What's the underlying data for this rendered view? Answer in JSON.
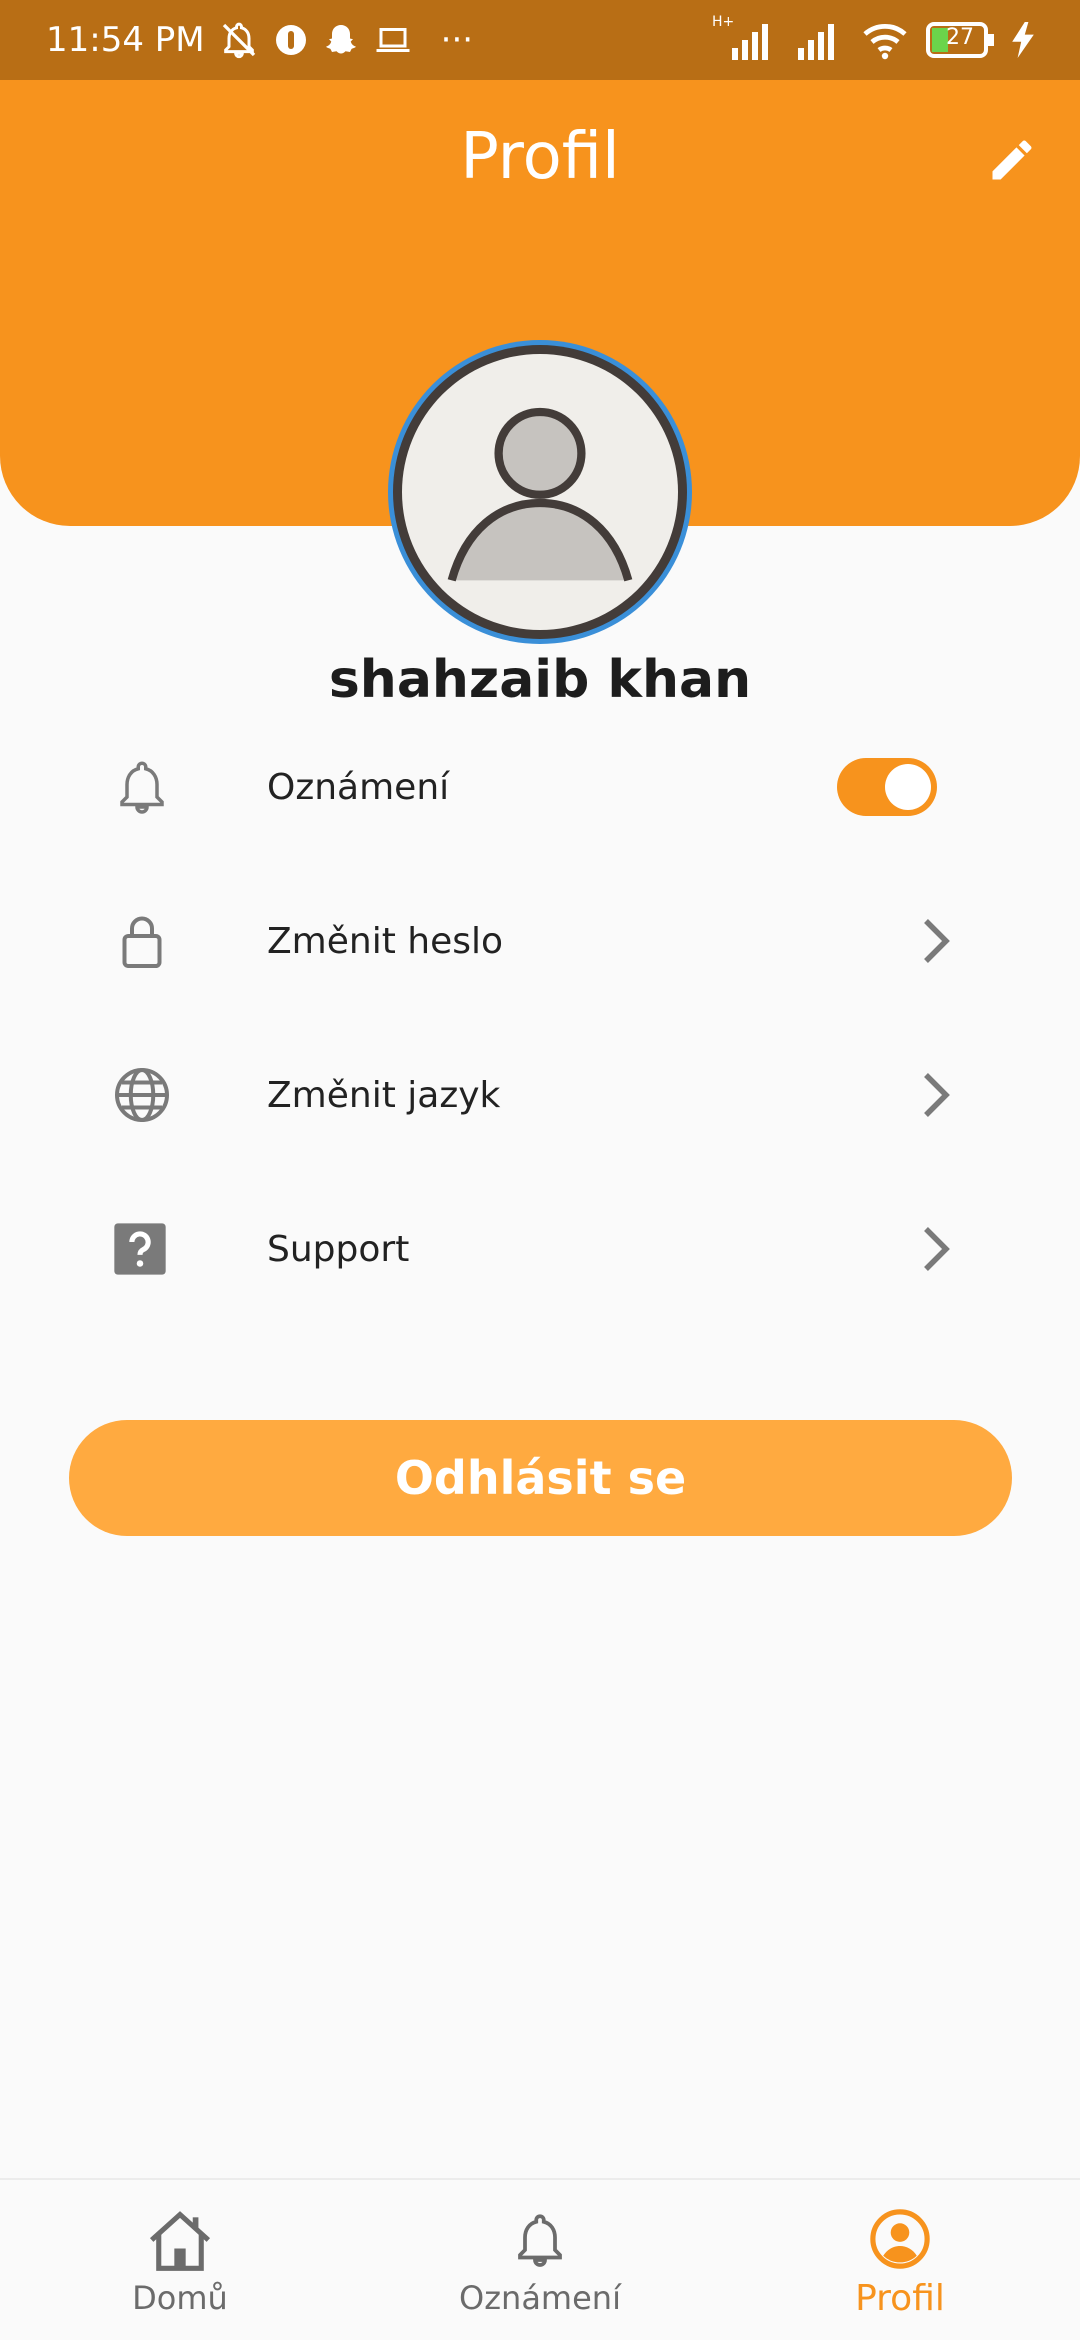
{
  "status_bar": {
    "time": "11:54 PM",
    "more": "···",
    "network_label": "H+",
    "battery": "27"
  },
  "header": {
    "title": "Profil"
  },
  "user": {
    "name": "shahzaib khan"
  },
  "menu": {
    "notifications_label": "Oznámení",
    "notifications_enabled": true,
    "change_password_label": "Změnit heslo",
    "change_language_label": "Změnit jazyk",
    "support_label": "Support"
  },
  "logout_label": "Odhlásit se",
  "bottom_nav": {
    "items": [
      {
        "label": "Domů",
        "icon": "home-icon"
      },
      {
        "label": "Oznámení",
        "icon": "bell-icon"
      },
      {
        "label": "Profil",
        "icon": "account-circle-icon"
      }
    ],
    "active": "Profil"
  },
  "colors": {
    "accent": "#f7931d",
    "status_bar": "#b86e15",
    "logout_button": "#ffaa40",
    "avatar_ring": "#3a8fd8"
  }
}
